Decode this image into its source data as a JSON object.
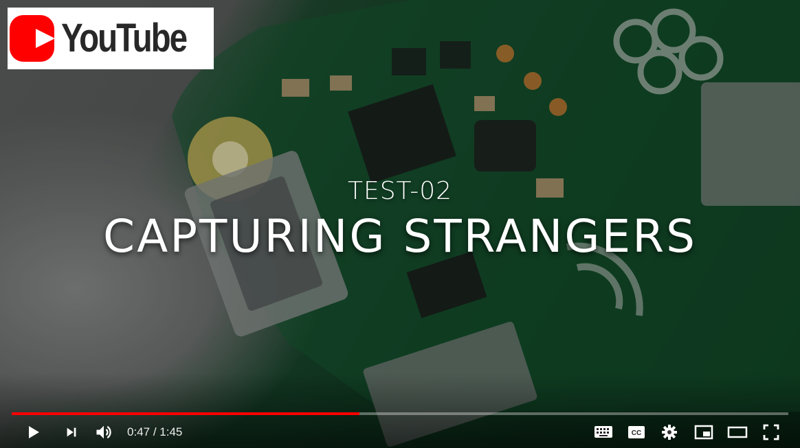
{
  "brand": {
    "logo_text": "YouTube",
    "logo_color": "#ff0000"
  },
  "video": {
    "subtitle": "TEST-02",
    "title": "CAPTURING STRANGERS"
  },
  "player": {
    "current_time": "0:47",
    "separator": " / ",
    "duration": "1:45",
    "progress_fraction": 0.4476,
    "progress_color": "#ff0000"
  },
  "controls": {
    "left": [
      "play-icon",
      "next-icon",
      "volume-icon"
    ],
    "right": [
      "keyboard-icon",
      "subtitles-icon",
      "settings-gear-icon",
      "miniplayer-icon",
      "theater-mode-icon",
      "fullscreen-icon"
    ]
  }
}
